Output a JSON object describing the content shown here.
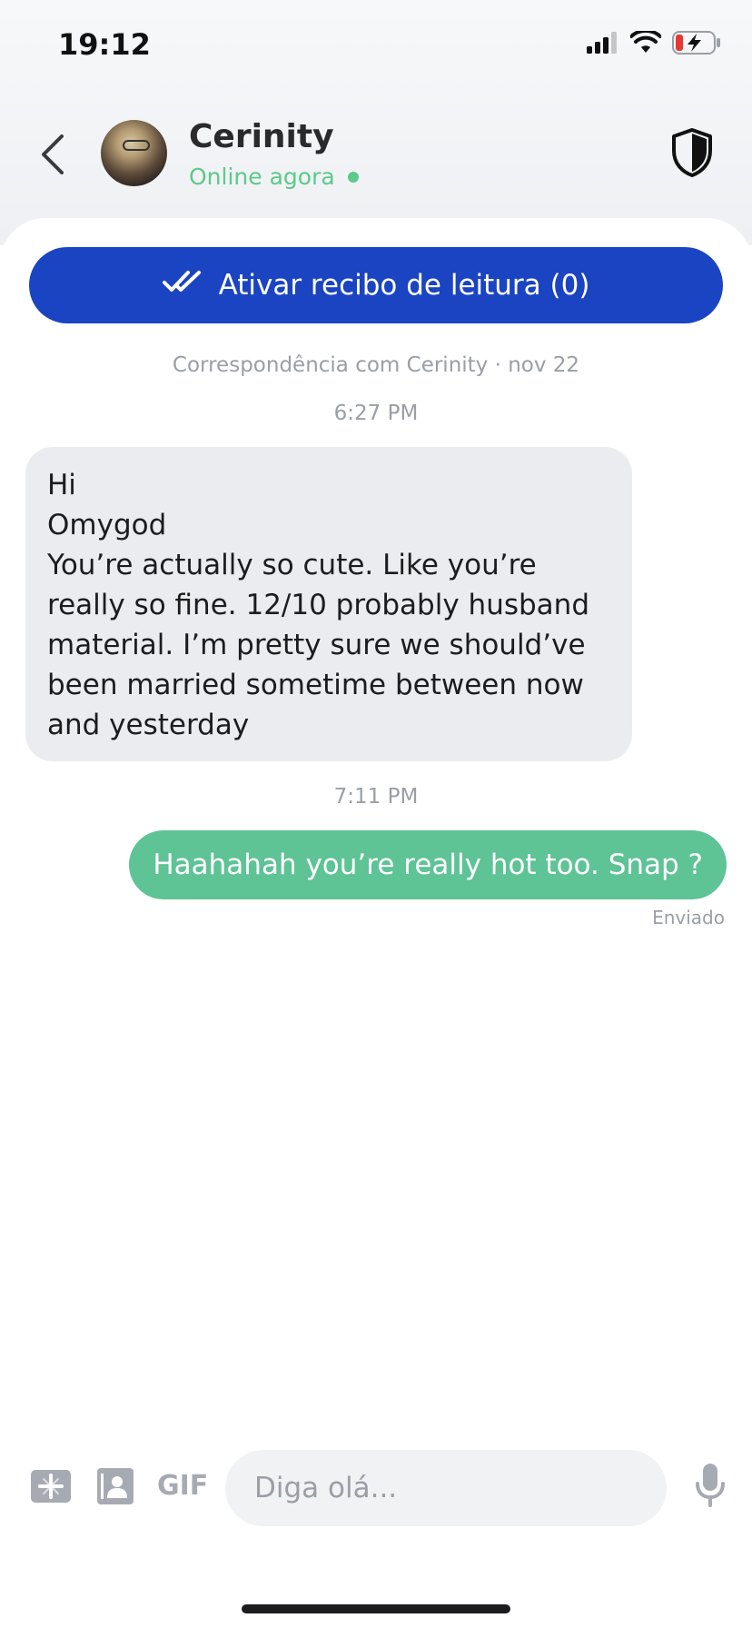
{
  "status_bar": {
    "time": "19:12"
  },
  "header": {
    "contact_name": "Cerinity",
    "contact_status": "Online agora"
  },
  "read_receipt": {
    "label": "Ativar recibo de leitura (0)"
  },
  "conversation": {
    "correspondence_line": "Correspondência com Cerinity · nov 22",
    "messages": [
      {
        "time": "6:27 PM",
        "direction": "incoming",
        "lines": [
          "Hi",
          "Omygod",
          "You’re actually so cute. Like you’re really so fine. 12/10 probably husband material. I’m pretty sure we should’ve been married sometime between now and yesterday"
        ]
      },
      {
        "time": "7:11 PM",
        "direction": "outgoing",
        "text": "Haahahah you’re really hot too. Snap ?",
        "status": "Enviado"
      }
    ]
  },
  "composer": {
    "gif_label": "GIF",
    "placeholder": "Diga olá..."
  },
  "colors": {
    "accent_blue": "#1b44c2",
    "outgoing_bubble": "#5ec395",
    "incoming_bubble": "#eaecef",
    "online_green": "#5cc98a"
  },
  "icons": {
    "back": "chevron-left-icon",
    "shield": "shield-icon",
    "double_check": "double-check-icon",
    "add_media": "add-media-icon",
    "contact_card": "contact-card-icon",
    "microphone": "microphone-icon"
  }
}
